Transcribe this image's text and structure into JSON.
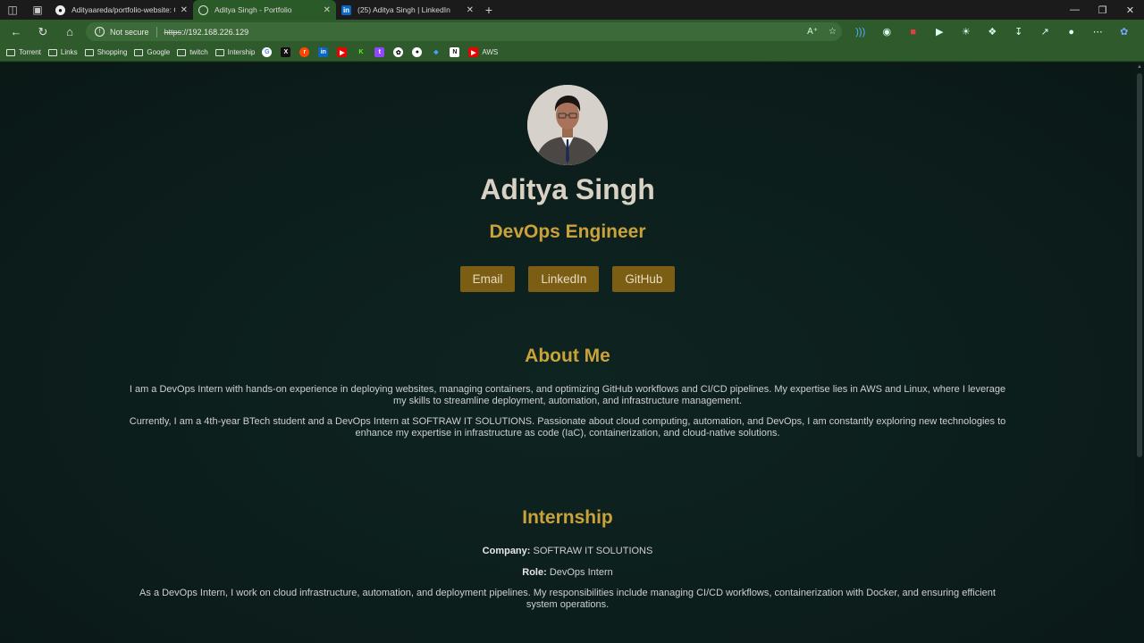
{
  "tabs": [
    {
      "title": "Adityaareda/portfolio-website: C",
      "favicon": "github-icon",
      "active": false
    },
    {
      "title": "Aditya Singh - Portfolio",
      "favicon": "globe-icon",
      "active": true
    },
    {
      "title": "(25) Aditya Singh | LinkedIn",
      "favicon": "linkedin-icon",
      "active": false
    }
  ],
  "address": {
    "security": "Not secure",
    "scheme": "https",
    "rest": "://192.168.226.129"
  },
  "bookmarks": {
    "folders": [
      "Torrent",
      "Links",
      "Shopping",
      "Google",
      "twitch",
      "Intership"
    ],
    "aws_label": "AWS"
  },
  "profile": {
    "name": "Aditya Singh",
    "role": "DevOps Engineer",
    "buttons": [
      "Email",
      "LinkedIn",
      "GitHub"
    ]
  },
  "about": {
    "heading": "About Me",
    "p1": "I am a DevOps Intern with hands-on experience in deploying websites, managing containers, and optimizing GitHub workflows and CI/CD pipelines. My expertise lies in AWS and Linux, where I leverage my skills to streamline deployment, automation, and infrastructure management.",
    "p2": "Currently, I am a 4th-year BTech student and a DevOps Intern at SOFTRAW IT SOLUTIONS. Passionate about cloud computing, automation, and DevOps, I am constantly exploring new technologies to enhance my expertise in infrastructure as code (IaC), containerization, and cloud-native solutions."
  },
  "internship": {
    "heading": "Internship",
    "company_label": "Company:",
    "company": "SOFTRAW IT SOLUTIONS",
    "role_label": "Role:",
    "role": "DevOps Intern",
    "desc": "As a DevOps Intern, I work on cloud infrastructure, automation, and deployment pipelines. My responsibilities include managing CI/CD workflows, containerization with Docker, and ensuring efficient system operations."
  },
  "colors": {
    "accent": "#c9a23a",
    "button": "#7b5d14",
    "chrome": "#2f5a2c"
  }
}
